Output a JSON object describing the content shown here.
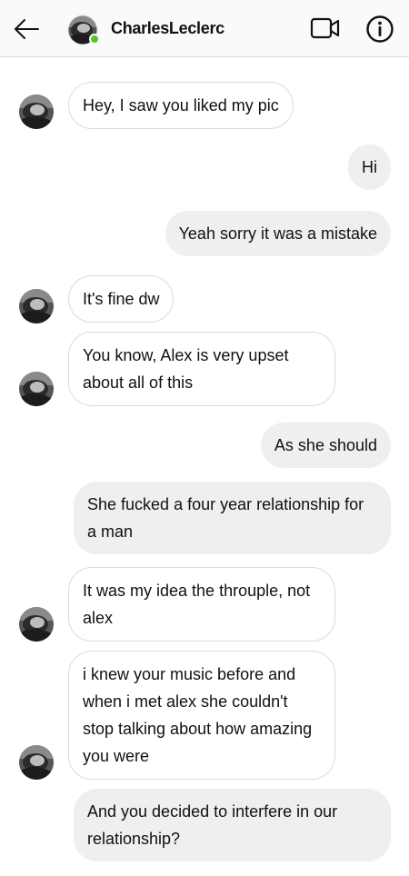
{
  "header": {
    "contact_name": "CharlesLeclerc",
    "online": true
  },
  "colors": {
    "online_dot": "#58c322",
    "incoming_bubble": "#ffffff",
    "incoming_border": "#dbdbdb",
    "outgoing_bubble": "#efefef"
  },
  "icons": {
    "back": "arrow-left-icon",
    "video": "video-call-icon",
    "info": "info-icon"
  },
  "messages": [
    {
      "from": "them",
      "text": "Hey, I saw you liked my pic"
    },
    {
      "from": "me",
      "text": "Hi"
    },
    {
      "from": "me",
      "text": "Yeah sorry it was a mistake"
    },
    {
      "from": "them",
      "text": "It's fine dw"
    },
    {
      "from": "them",
      "text": "You know, Alex is very upset about all of this"
    },
    {
      "from": "me",
      "text": "As she should"
    },
    {
      "from": "me",
      "text": "She fucked a four year relationship for a man"
    },
    {
      "from": "them",
      "text": "It was my idea the throuple, not alex"
    },
    {
      "from": "them",
      "text": "i knew your music before and when i met alex she couldn't stop talking about how amazing you were"
    },
    {
      "from": "me",
      "text": "And you decided to interfere in our relationship?"
    }
  ]
}
